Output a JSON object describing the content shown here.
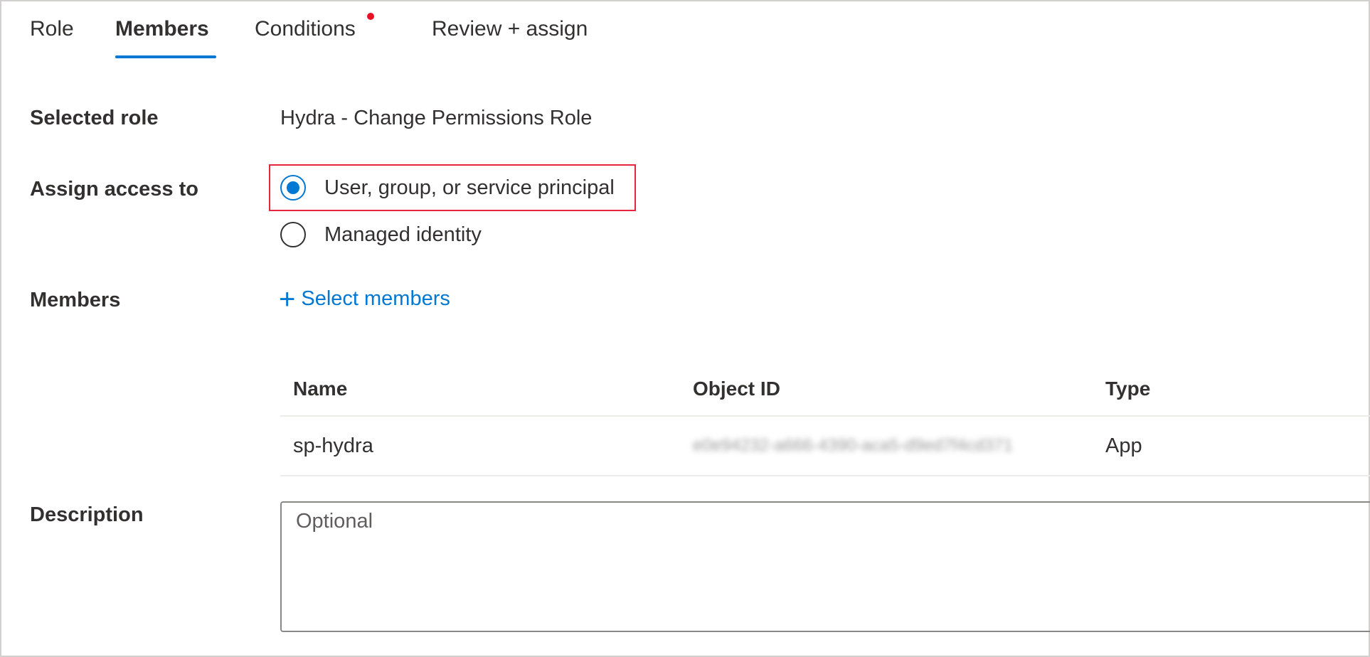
{
  "tabs": [
    {
      "label": "Role",
      "active": false
    },
    {
      "label": "Members",
      "active": true
    },
    {
      "label": "Conditions",
      "active": false,
      "has_indicator": true
    },
    {
      "label": "Review + assign",
      "active": false
    }
  ],
  "form": {
    "selected_role_label": "Selected role",
    "selected_role_value": "Hydra - Change Permissions Role",
    "assign_access_label": "Assign access to",
    "assign_options": [
      {
        "label": "User, group, or service principal",
        "checked": true
      },
      {
        "label": "Managed identity",
        "checked": false
      }
    ],
    "members_label": "Members",
    "select_members_link": "Select members",
    "description_label": "Description",
    "description_placeholder": "Optional"
  },
  "members_table": {
    "columns": [
      "Name",
      "Object ID",
      "Type"
    ],
    "rows": [
      {
        "name": "sp-hydra",
        "object_id": "e0e94232-a666-4390-aca5-d9ed7f4cd371",
        "type": "App"
      }
    ]
  },
  "colors": {
    "accent": "#0078d4",
    "highlight": "#e6263f",
    "indicator": "#e81123"
  }
}
